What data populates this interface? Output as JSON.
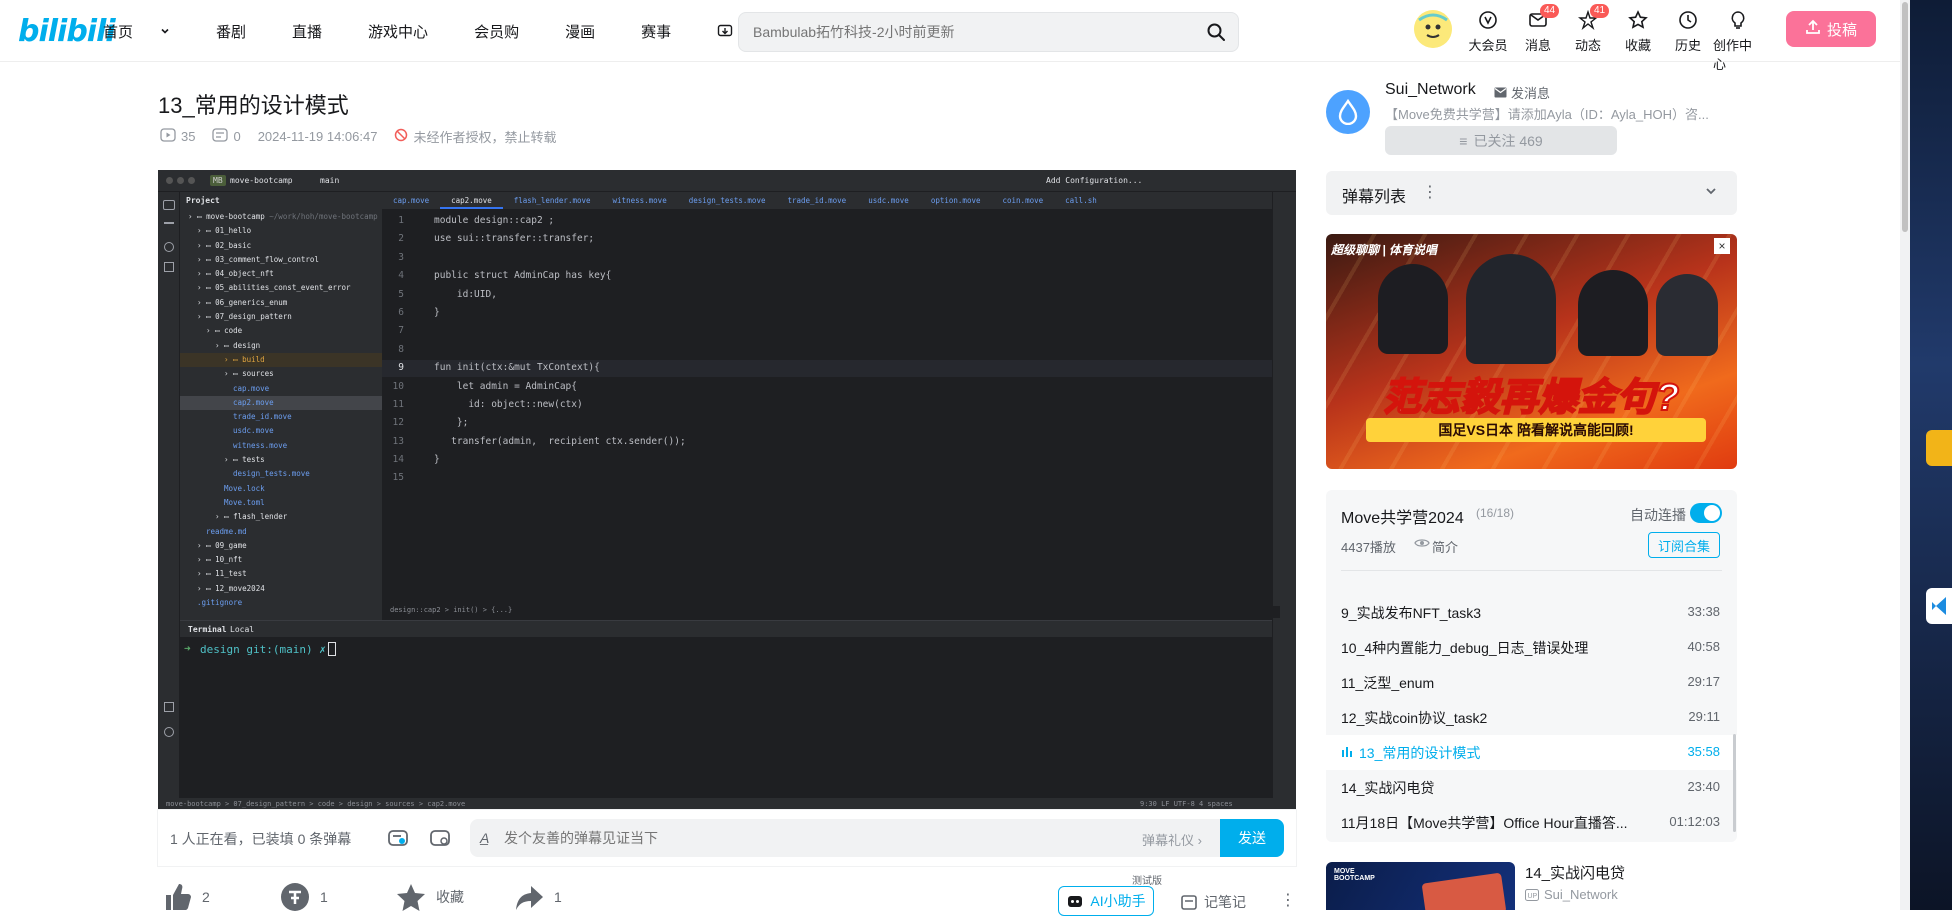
{
  "header": {
    "logo": "bilibili",
    "nav": [
      "首页",
      "番剧",
      "直播",
      "游戏中心",
      "会员购",
      "漫画",
      "赛事",
      "下载客户端"
    ],
    "search_placeholder": "Bambulab拓竹科技-2小时前更新",
    "icons": [
      {
        "label": "大会员",
        "icon": "vip-icon",
        "badge": ""
      },
      {
        "label": "消息",
        "icon": "message-icon",
        "badge": "44"
      },
      {
        "label": "动态",
        "icon": "dynamic-icon",
        "badge": "41"
      },
      {
        "label": "收藏",
        "icon": "star-icon",
        "badge": ""
      },
      {
        "label": "历史",
        "icon": "history-icon",
        "badge": ""
      },
      {
        "label": "创作中心",
        "icon": "bulb-icon",
        "badge": ""
      }
    ],
    "upload_label": "投稿"
  },
  "video": {
    "title": "13_常用的设计模式",
    "views": "35",
    "danmaku_count": "0",
    "date": "2024-11-19 14:06:47",
    "copyright": "未经作者授权，禁止转载"
  },
  "ide": {
    "project": "move-bootcamp",
    "branch": "main",
    "config": "Add Configuration...",
    "tabs": [
      "cap.move",
      "cap2.move",
      "flash_lender.move",
      "witness.move",
      "design_tests.move",
      "trade_id.move",
      "usdc.move",
      "option.move",
      "coin.move",
      "call.sh"
    ],
    "project_label": "Project",
    "tree": [
      {
        "d": 0,
        "t": "move-bootcamp",
        "s": " ~/work/hoh/move-bootcamp"
      },
      {
        "d": 1,
        "t": "01_hello"
      },
      {
        "d": 1,
        "t": "02_basic"
      },
      {
        "d": 1,
        "t": "03_comment_flow_control"
      },
      {
        "d": 1,
        "t": "04_object_nft"
      },
      {
        "d": 1,
        "t": "05_abilities_const_event_error"
      },
      {
        "d": 1,
        "t": "06_generics_enum"
      },
      {
        "d": 1,
        "t": "07_design_pattern"
      },
      {
        "d": 2,
        "t": "code"
      },
      {
        "d": 3,
        "t": "design"
      },
      {
        "d": 4,
        "t": "build"
      },
      {
        "d": 4,
        "t": "sources"
      },
      {
        "d": 5,
        "t": "cap.move"
      },
      {
        "d": 5,
        "t": "cap2.move"
      },
      {
        "d": 5,
        "t": "trade_id.move"
      },
      {
        "d": 5,
        "t": "usdc.move"
      },
      {
        "d": 5,
        "t": "witness.move"
      },
      {
        "d": 4,
        "t": "tests"
      },
      {
        "d": 5,
        "t": "design_tests.move"
      },
      {
        "d": 4,
        "t": "Move.lock"
      },
      {
        "d": 4,
        "t": "Move.toml"
      },
      {
        "d": 3,
        "t": "flash_lender"
      },
      {
        "d": 2,
        "t": "readme.md"
      },
      {
        "d": 1,
        "t": "09_game"
      },
      {
        "d": 1,
        "t": "10_nft"
      },
      {
        "d": 1,
        "t": "11_test"
      },
      {
        "d": 1,
        "t": "12_move2024"
      },
      {
        "d": 1,
        "t": ".gitignore"
      }
    ],
    "code": [
      "module design::cap2 ;",
      "use sui::transfer::transfer;",
      "",
      "public struct AdminCap has key{",
      "    id:UID,",
      "}",
      "",
      "",
      "fun init(ctx:&mut TxContext){",
      "    let admin = AdminCap{",
      "      id: object::new(ctx)",
      "    };",
      "   transfer(admin,  recipient ctx.sender());",
      "}",
      ""
    ],
    "breadcrumb": "design::cap2   >   init()   >   {...}",
    "terminal_tab": "Terminal",
    "terminal_local": "Local",
    "terminal_prompt": "design git:(main) ✗",
    "status_path": "move-bootcamp  >  07_design_pattern  >  code  >  design  >  sources  >  cap2.move",
    "status_right": "9:30   LF   UTF-8   4 spaces"
  },
  "danmaku": {
    "watching": "1 人正在看，已装填 0 条弹幕",
    "placeholder": "发个友善的弹幕见证当下",
    "etiquette": "弹幕礼仪",
    "send": "发送"
  },
  "actions": {
    "like": "2",
    "coin": "1",
    "favorite": "收藏",
    "share": "1",
    "ai_tag": "测试版",
    "ai": "AI小助手",
    "notes": "记笔记"
  },
  "uploader": {
    "name": "Sui_Network",
    "message": "发消息",
    "desc": "【Move免费共学营】请添加Ayla（ID：Ayla_HOH）咨...",
    "follow": "已关注 469"
  },
  "danmaku_list": {
    "title": "弹幕列表"
  },
  "ad": {
    "text": "范志毅再爆金句?",
    "sub": "国足VS日本 陪看解说高能回顾!",
    "tag": "超级聊聊 | 体育说唱"
  },
  "playlist": {
    "title": "Move共学营2024",
    "count": "(16/18)",
    "autoplay": "自动连播",
    "plays": "4437播放",
    "intro": "简介",
    "subscribe": "订阅合集",
    "items": [
      {
        "title": "9_实战发布NFT_task3",
        "duration": "33:38",
        "active": false
      },
      {
        "title": "10_4种内置能力_debug_日志_错误处理",
        "duration": "40:58",
        "active": false
      },
      {
        "title": "11_泛型_enum",
        "duration": "29:17",
        "active": false
      },
      {
        "title": "12_实战coin协议_task2",
        "duration": "29:11",
        "active": false
      },
      {
        "title": "13_常用的设计模式",
        "duration": "35:58",
        "active": true
      },
      {
        "title": "14_实战闪电贷",
        "duration": "23:40",
        "active": false
      },
      {
        "title": "11月18日【Move共学营】Office Hour直播答...",
        "duration": "01:12:03",
        "active": false
      }
    ]
  },
  "recommend": {
    "title": "14_实战闪电贷",
    "author": "Sui_Network"
  },
  "colors": {
    "brand": "#00aeec",
    "pink": "#fb7299",
    "text": "#18191c",
    "grey": "#9499a0"
  }
}
